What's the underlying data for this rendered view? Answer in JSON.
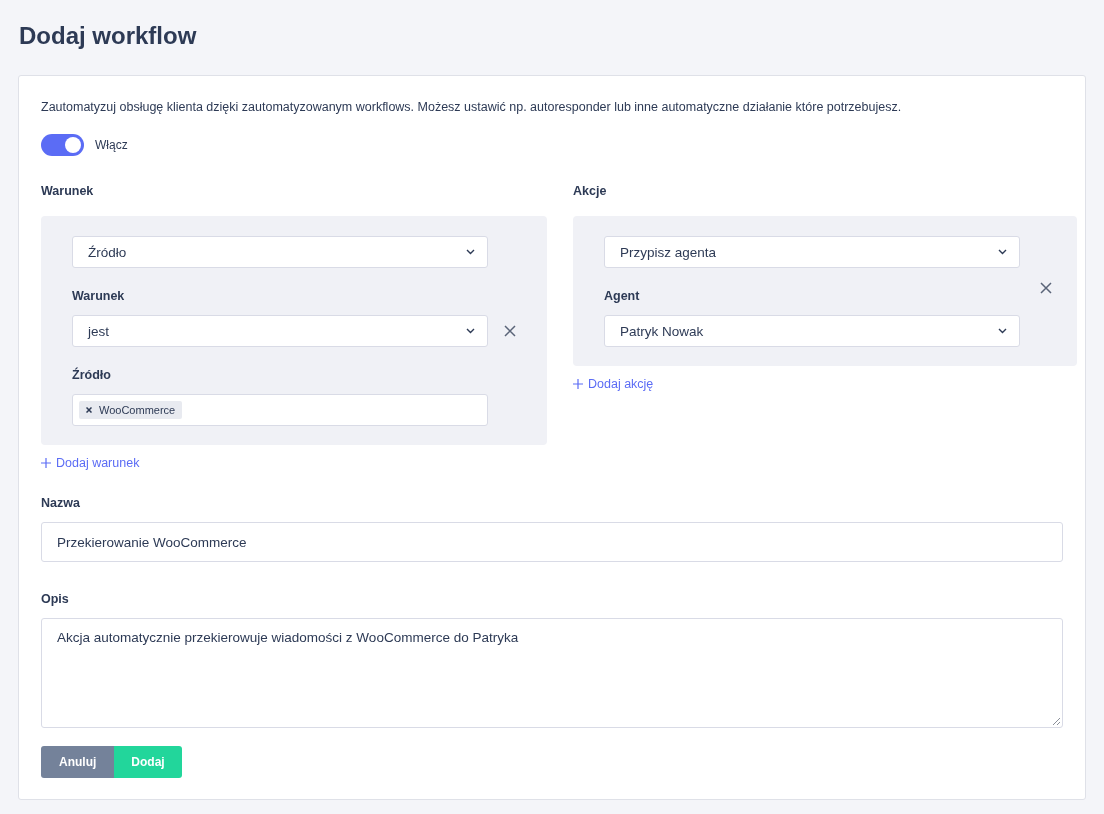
{
  "title": "Dodaj workflow",
  "intro": "Zautomatyzuj obsługę klienta dzięki zautomatyzowanym workflows. Możesz ustawić np. autoresponder lub inne automatyczne działanie które potrzebujesz.",
  "toggle": {
    "label": "Włącz",
    "on": true
  },
  "conditions": {
    "heading": "Warunek",
    "items": [
      {
        "type_select": "Źródło",
        "operator_label": "Warunek",
        "operator": "jest",
        "value_label": "Źródło",
        "tags": [
          "WooCommerce"
        ]
      }
    ],
    "add_link": "Dodaj warunek"
  },
  "actions": {
    "heading": "Akcje",
    "items": [
      {
        "type_select": "Przypisz agenta",
        "agent_label": "Agent",
        "agent": "Patryk Nowak"
      }
    ],
    "add_link": "Dodaj akcję"
  },
  "name": {
    "label": "Nazwa",
    "value": "Przekierowanie WooCommerce"
  },
  "description": {
    "label": "Opis",
    "value": "Akcja automatycznie przekierowuje wiadomości z WooCommerce do Patryka"
  },
  "buttons": [
    {
      "label": "Anuluj",
      "kind": "secondary"
    },
    {
      "label": "Dodaj",
      "kind": "primary"
    }
  ]
}
